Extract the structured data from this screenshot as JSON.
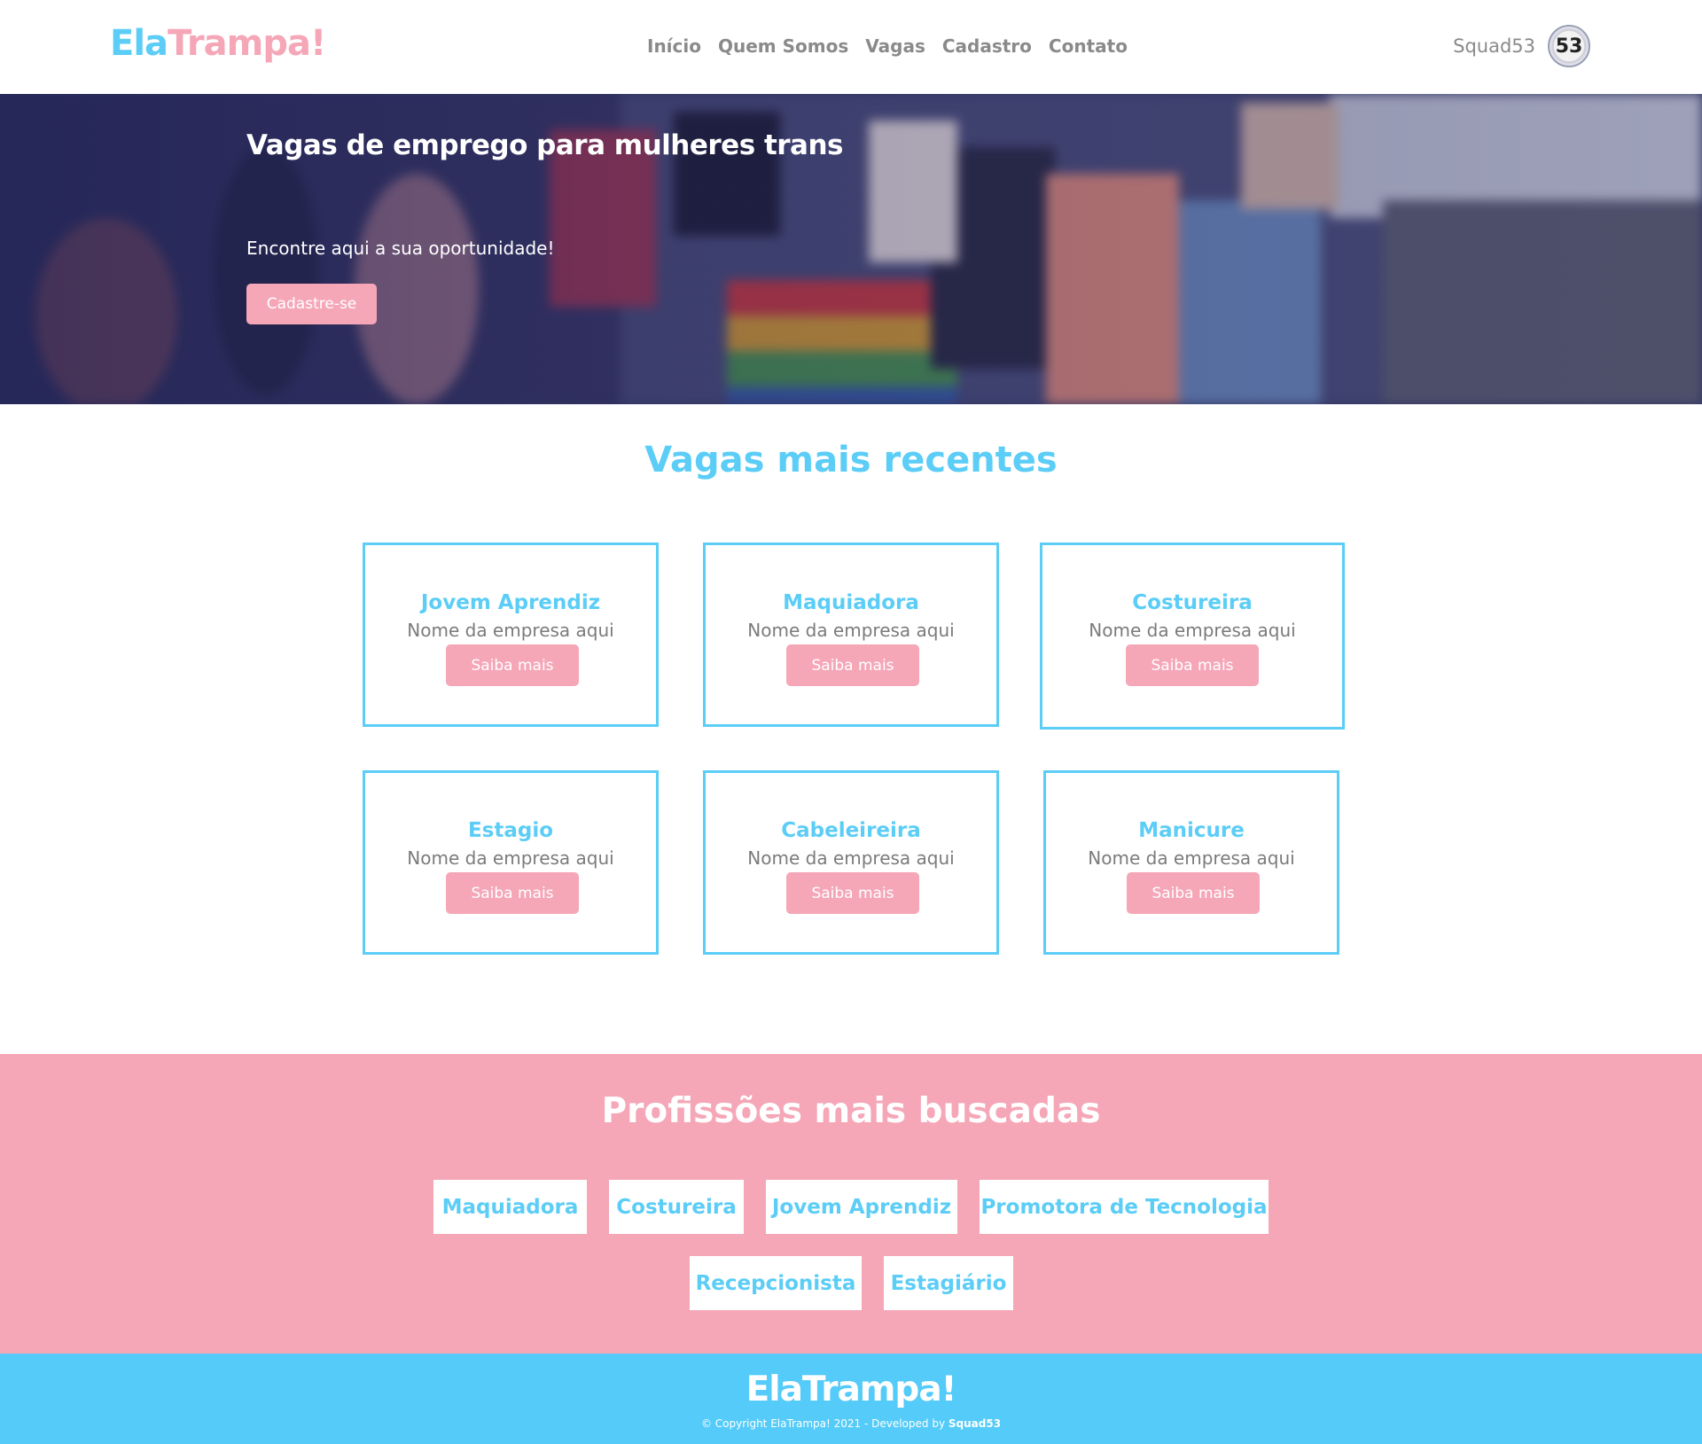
{
  "header": {
    "logo_part1": "Ela",
    "logo_part2": "Trampa!",
    "nav": [
      "Início",
      "Quem Somos",
      "Vagas",
      "Cadastro",
      "Contato"
    ],
    "user_name": "Squad53",
    "avatar_text": "53"
  },
  "hero": {
    "title": "Vagas de emprego para mulheres trans",
    "subtitle": "Encontre aqui a sua oportunidade!",
    "button": "Cadastre-se"
  },
  "recent": {
    "title": "Vagas mais recentes",
    "jobs": [
      {
        "title": "Jovem Aprendiz",
        "company": "Nome da empresa aqui",
        "button": "Saiba mais"
      },
      {
        "title": "Maquiadora",
        "company": "Nome da empresa aqui",
        "button": "Saiba mais"
      },
      {
        "title": "Costureira",
        "company": "Nome da empresa aqui",
        "button": "Saiba mais"
      },
      {
        "title": "Estagio",
        "company": "Nome da empresa aqui",
        "button": "Saiba mais"
      },
      {
        "title": "Cabeleireira",
        "company": "Nome da empresa aqui",
        "button": "Saiba mais"
      },
      {
        "title": "Manicure",
        "company": "Nome da empresa aqui",
        "button": "Saiba mais"
      }
    ]
  },
  "professions": {
    "title": "Profissões mais buscadas",
    "items": [
      "Maquiadora",
      "Costureira",
      "Jovem Aprendiz",
      "Promotora de Tecnologia",
      "Recepcionista",
      "Estagiário"
    ]
  },
  "footer": {
    "logo": "ElaTrampa!",
    "copyright": "© Copyright ElaTrampa! 2021 - Developed by",
    "developer": "Squad53"
  },
  "colors": {
    "brand_blue": "#5bcdf6",
    "brand_pink": "#f5a7b8",
    "footer_blue": "#55cbf9"
  }
}
